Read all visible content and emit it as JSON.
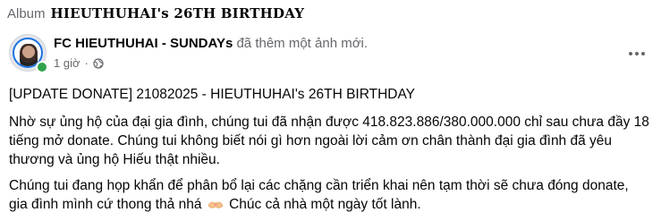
{
  "album": {
    "prefix": "Album",
    "title": "HIEUTHUHAI's 26TH BIRTHDAY"
  },
  "post": {
    "author": "FC HIEUTHUHAI - SUNDAYs",
    "action": "đã thêm một ảnh mới.",
    "time": "1 giờ",
    "separator": "·",
    "audience_icon": "globe-icon",
    "more_icon": "more-options-icon"
  },
  "content": {
    "title": "[UPDATE DONATE] 21082025 - HIEUTHUHAI's 26TH BIRTHDAY",
    "paragraph1": "Nhờ sự ủng hộ của đại gia đình, chúng tui đã nhận được 418.823.886/380.000.000 chỉ sau chưa đầy 18 tiếng mở donate. Chúng tui không biết nói gì hơn ngoài lời cảm ơn chân thành đại gia đình đã yêu thương và ủng hộ Hiếu thật nhiều.",
    "paragraph2_part1": "Chúng tui đang họp khẩn để phân bổ lại các chặng cần triển khai nên tạm thời sẽ chưa đóng donate, gia đình mình cứ thong thả nhá",
    "paragraph2_emoji": "heart-hands-emoji",
    "paragraph2_part2": "Chúc cả nhà một ngày tốt lành."
  },
  "colors": {
    "text": "#050505",
    "secondary": "#65676b",
    "accent": "#1b74e4",
    "online": "#31a24c"
  }
}
